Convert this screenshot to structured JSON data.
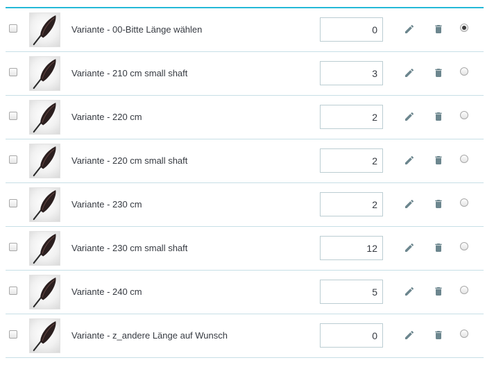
{
  "accent_color": "#25b9d7",
  "icons": {
    "edit": "pencil-icon",
    "delete": "trash-icon",
    "thumbnail": "paddle-blade-image"
  },
  "variants": [
    {
      "name": "Variante - 00-Bitte Länge wählen",
      "quantity": "0",
      "selected": false,
      "default": true
    },
    {
      "name": "Variante - 210 cm small shaft",
      "quantity": "3",
      "selected": false,
      "default": false
    },
    {
      "name": "Variante - 220 cm",
      "quantity": "2",
      "selected": false,
      "default": false
    },
    {
      "name": "Variante - 220 cm small shaft",
      "quantity": "2",
      "selected": false,
      "default": false
    },
    {
      "name": "Variante - 230 cm",
      "quantity": "2",
      "selected": false,
      "default": false
    },
    {
      "name": "Variante - 230 cm small shaft",
      "quantity": "12",
      "selected": false,
      "default": false
    },
    {
      "name": "Variante - 240 cm",
      "quantity": "5",
      "selected": false,
      "default": false
    },
    {
      "name": "Variante - z_andere Länge auf Wunsch",
      "quantity": "0",
      "selected": false,
      "default": false
    }
  ]
}
